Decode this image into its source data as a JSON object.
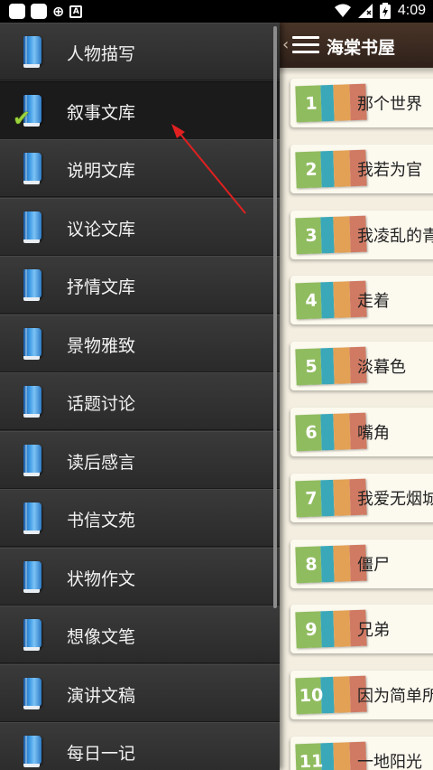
{
  "status_bar": {
    "left_icons": [
      "notification-square-icon",
      "notification-square-icon",
      "app-notification-icon",
      "a-notification-icon"
    ],
    "right_icons": [
      "wifi-icon",
      "signal-icon",
      "battery-icon"
    ],
    "time": "4:09"
  },
  "header": {
    "title": "海棠书屋",
    "icons": [
      "back-chevron-icon",
      "menu-icon"
    ]
  },
  "drawer": {
    "items": [
      {
        "label": "人物描写",
        "selected": false
      },
      {
        "label": "叙事文库",
        "selected": true
      },
      {
        "label": "说明文库",
        "selected": false
      },
      {
        "label": "议论文库",
        "selected": false
      },
      {
        "label": "抒情文库",
        "selected": false
      },
      {
        "label": "景物雅致",
        "selected": false
      },
      {
        "label": "话题讨论",
        "selected": false
      },
      {
        "label": "读后感言",
        "selected": false
      },
      {
        "label": "书信文苑",
        "selected": false
      },
      {
        "label": "状物作文",
        "selected": false
      },
      {
        "label": "想像文笔",
        "selected": false
      },
      {
        "label": "演讲文稿",
        "selected": false
      },
      {
        "label": "每日一记",
        "selected": false
      }
    ],
    "item_icon": "book-icon",
    "selected_icon": "checkmark-icon"
  },
  "articles": [
    {
      "number": "1",
      "title": "那个世界"
    },
    {
      "number": "2",
      "title": "我若为官"
    },
    {
      "number": "3",
      "title": "我凌乱的青"
    },
    {
      "number": "4",
      "title": "走着"
    },
    {
      "number": "5",
      "title": "淡暮色"
    },
    {
      "number": "6",
      "title": "嘴角"
    },
    {
      "number": "7",
      "title": "我爱无烟城"
    },
    {
      "number": "8",
      "title": "僵尸"
    },
    {
      "number": "9",
      "title": "兄弟"
    },
    {
      "number": "10",
      "title": "因为简单所"
    },
    {
      "number": "11",
      "title": "一地阳光"
    }
  ],
  "colors": {
    "accent_arrow": "#e02020",
    "header_bg": "#3b2a20",
    "drawer_bg": "#2c2c2c",
    "tag_colors": [
      "#8fbc5f",
      "#3aa8b9",
      "#e3a155",
      "#d07a63"
    ]
  }
}
